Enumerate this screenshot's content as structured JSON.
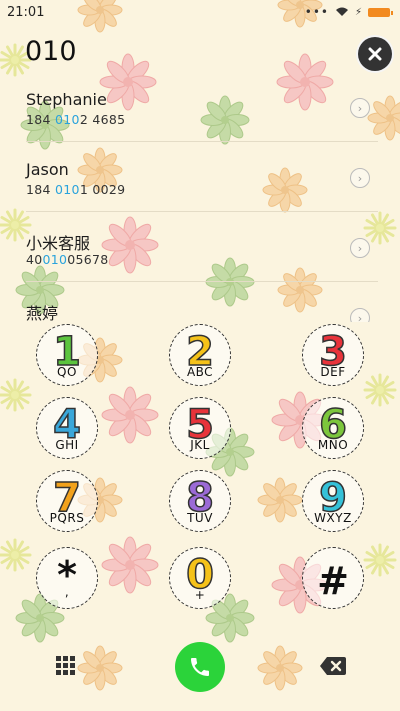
{
  "status_bar": {
    "time": "21:01",
    "overflow_text": "•••"
  },
  "dialer": {
    "input_digits": "010"
  },
  "contacts": [
    {
      "name": "Stephanie",
      "number_parts": [
        "184 ",
        "010",
        "2 4685"
      ]
    },
    {
      "name": "Jason",
      "number_parts": [
        "184 ",
        "010",
        "1 0029"
      ]
    },
    {
      "name": "小米客服",
      "number_parts": [
        "40",
        "010",
        "05678"
      ]
    },
    {
      "name": "燕婷",
      "number_parts": [
        "",
        "",
        ""
      ]
    }
  ],
  "keypad": {
    "keys": [
      {
        "digit": "1",
        "letters": "QO",
        "color": "#5cc43e"
      },
      {
        "digit": "2",
        "letters": "ABC",
        "color": "#f5c219"
      },
      {
        "digit": "3",
        "letters": "DEF",
        "color": "#e8333a"
      },
      {
        "digit": "4",
        "letters": "GHI",
        "color": "#3aa7d9"
      },
      {
        "digit": "5",
        "letters": "JKL",
        "color": "#e8333a"
      },
      {
        "digit": "6",
        "letters": "MNO",
        "color": "#7cc63c"
      },
      {
        "digit": "7",
        "letters": "PQRS",
        "color": "#f2a21c"
      },
      {
        "digit": "8",
        "letters": "TUV",
        "color": "#9b6ad6"
      },
      {
        "digit": "9",
        "letters": "WXYZ",
        "color": "#35c1d8"
      },
      {
        "digit": "*",
        "letters": ",",
        "color": "#111111"
      },
      {
        "digit": "0",
        "letters": "+",
        "color": "#f5c219"
      },
      {
        "digit": "#",
        "letters": "",
        "color": "#111111"
      }
    ]
  },
  "bottom_bar": {
    "left_icon": "dialpad-grid-icon",
    "center_icon": "phone-call-icon",
    "right_icon": "backspace-icon"
  },
  "colors": {
    "background": "#fbf4df",
    "highlight": "#2aa3dc",
    "call_green": "#2bd33a",
    "battery": "#f28a1f"
  }
}
